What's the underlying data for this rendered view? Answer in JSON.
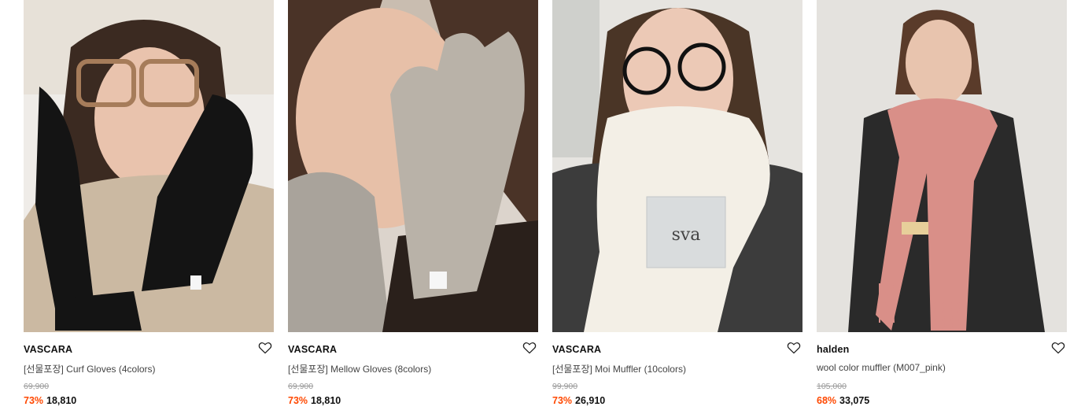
{
  "products": [
    {
      "brand": "VASCARA",
      "name": "[선물포장] Curf Gloves (4colors)",
      "original_price": "69,900",
      "discount": "73%",
      "price": "18,810",
      "image": {
        "bg": "#efece8",
        "top": "#e7e1d8",
        "hair": "#3b2a21",
        "skin": "#e9c3ad",
        "garment": "#cbb9a2",
        "accent": "#141414",
        "label": "#f6f6f6"
      }
    },
    {
      "brand": "VASCARA",
      "name": "[선물포장] Mellow Gloves (8colors)",
      "original_price": "69,900",
      "discount": "73%",
      "price": "18,810",
      "image": {
        "bg": "#dcd4cc",
        "top": "#c9bdb0",
        "hair": "#4a3327",
        "skin": "#e7c0a8",
        "garment": "#a9a39b",
        "accent": "#b9b2a8",
        "label": "#f6f6f6"
      }
    },
    {
      "brand": "VASCARA",
      "name": "[선물포장] Moi Muffler (10colors)",
      "original_price": "99,900",
      "discount": "73%",
      "price": "26,910",
      "image": {
        "bg": "#e6e4e0",
        "top": "#cfd0cc",
        "hair": "#4a3526",
        "skin": "#ecc9b6",
        "garment": "#3c3c3c",
        "accent": "#f3efe6",
        "label": "#d9dcdd"
      }
    },
    {
      "brand": "halden",
      "name": "wool color muffler (M007_pink)",
      "original_price": "105,000",
      "discount": "68%",
      "price": "33,075",
      "image": {
        "bg": "#e4e2de",
        "top": "#dddad5",
        "hair": "#5a3b2a",
        "skin": "#e8c4ae",
        "garment": "#2a2a2a",
        "accent": "#d98f88",
        "label": "#e7cf9a"
      }
    }
  ]
}
